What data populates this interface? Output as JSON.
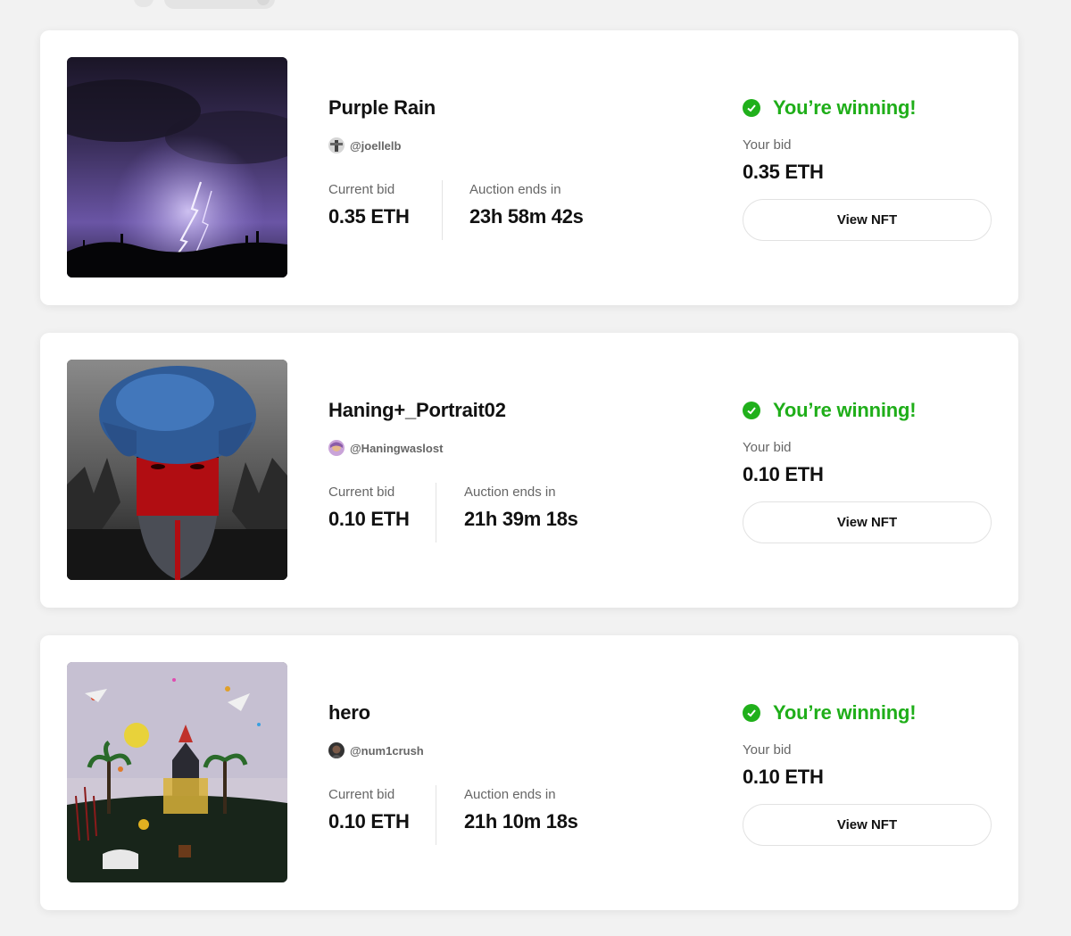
{
  "colors": {
    "success": "#1fae19",
    "background": "#f2f2f2",
    "card": "#ffffff"
  },
  "bids": [
    {
      "title": "Purple Rain",
      "creator": "@joellelb",
      "current_bid_label": "Current bid",
      "current_bid": "0.35 ETH",
      "auction_label": "Auction ends in",
      "auction_time": "23h 58m 42s",
      "status": "You’re winning!",
      "your_bid_label": "Your bid",
      "your_bid": "0.35 ETH",
      "button": "View NFT"
    },
    {
      "title": "Haning+_Portrait02",
      "creator": "@Haningwaslost",
      "current_bid_label": "Current bid",
      "current_bid": "0.10 ETH",
      "auction_label": "Auction ends in",
      "auction_time": "21h 39m 18s",
      "status": "You’re winning!",
      "your_bid_label": "Your bid",
      "your_bid": "0.10 ETH",
      "button": "View NFT"
    },
    {
      "title": "hero",
      "creator": "@num1crush",
      "current_bid_label": "Current bid",
      "current_bid": "0.10 ETH",
      "auction_label": "Auction ends in",
      "auction_time": "21h 10m 18s",
      "status": "You’re winning!",
      "your_bid_label": "Your bid",
      "your_bid": "0.10 ETH",
      "button": "View NFT"
    }
  ]
}
